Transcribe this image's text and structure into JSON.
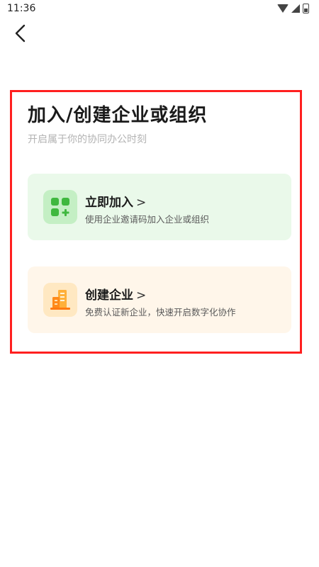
{
  "status_bar": {
    "time": "11:36"
  },
  "page": {
    "title": "加入/创建企业或组织",
    "subtitle": "开启属于你的协同办公时刻"
  },
  "options": [
    {
      "title": "立即加入",
      "chevron": ">",
      "description": "使用企业邀请码加入企业或组织",
      "icon": "grid-add-icon",
      "accent": "#44c044"
    },
    {
      "title": "创建企业",
      "chevron": ">",
      "description": "免费认证新企业，快速开启数字化协作",
      "icon": "building-icon",
      "accent": "#ff9a1f"
    }
  ],
  "highlight_color": "#ff1f1f"
}
